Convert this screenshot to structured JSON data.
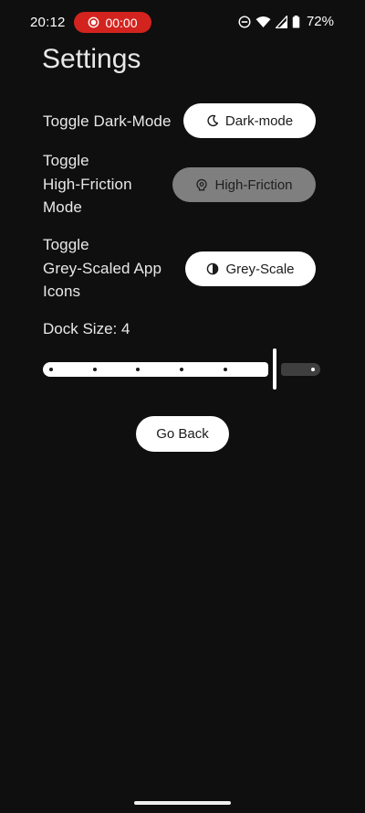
{
  "status_bar": {
    "time": "20:12",
    "recording_timer": "00:00",
    "battery_percent": "72%",
    "icons": [
      "screen-record-icon",
      "do-not-disturb-icon",
      "wifi-icon",
      "cell-signal-icon",
      "battery-icon"
    ]
  },
  "page": {
    "title": "Settings"
  },
  "settings": {
    "dark_mode": {
      "label": "Toggle Dark-Mode",
      "button_label": "Dark-mode",
      "icon": "moon-icon"
    },
    "high_friction": {
      "label_line1": "Toggle",
      "label_line2": "High-Friction",
      "label_line3": "Mode",
      "button_label": "High-Friction",
      "icon": "brain-icon"
    },
    "grey_scale": {
      "label_line1": "Toggle",
      "label_line2": "Grey-Scaled App",
      "label_line3": "Icons",
      "button_label": "Grey-Scale",
      "icon": "contrast-icon"
    }
  },
  "dock": {
    "label": "Dock Size: 4",
    "value": 4,
    "min": 0,
    "max": 5
  },
  "actions": {
    "go_back_label": "Go Back"
  },
  "colors": {
    "background": "#0f0f0f",
    "record_pill": "#d3231f",
    "button_white": "#ffffff",
    "button_disabled": "#7f7f7f"
  }
}
